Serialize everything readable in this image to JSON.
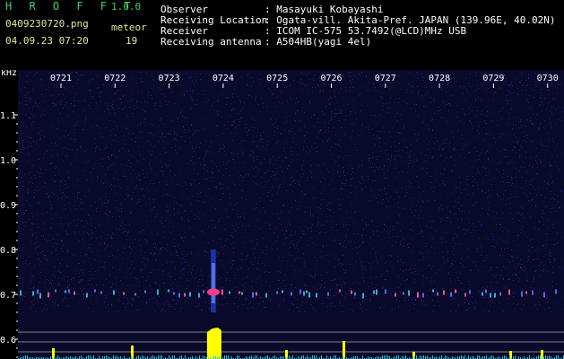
{
  "header": {
    "app_name": "H R O F F T",
    "version": "1.0.0",
    "filename": "0409230720.png",
    "datetime": "04.09.23 07:20",
    "meteor_label": "meteor",
    "meteor_count": "19",
    "fields": [
      {
        "label": "Observer",
        "value": ": Masayuki Kobayashi"
      },
      {
        "label": "Receiving Location",
        "value": ": Ogata-vill. Akita-Pref. JAPAN (139.96E, 40.02N)"
      },
      {
        "label": "Receiver",
        "value": ": ICOM IC-575 53.7492(@LCD)MHz USB"
      },
      {
        "label": "Receiving antenna",
        "value": ": A504HB(yagi 4el)"
      }
    ]
  },
  "spectrogram": {
    "y_unit": "kHz",
    "y_ticks": [
      "1.1",
      "1.0",
      "0.9",
      "0.8",
      "0.7",
      "0.6"
    ],
    "time_ticks": [
      "0721",
      "0722",
      "0723",
      "0724",
      "0725",
      "0726",
      "0727",
      "0728",
      "0729",
      "0730"
    ],
    "meteor_event_minute": "0724",
    "colors": {
      "background": "#0a0a2a",
      "noise": "#2a2aa0",
      "signal": "#ff3c8c",
      "bars": "#ffff00",
      "axis": "#ffffff"
    }
  }
}
